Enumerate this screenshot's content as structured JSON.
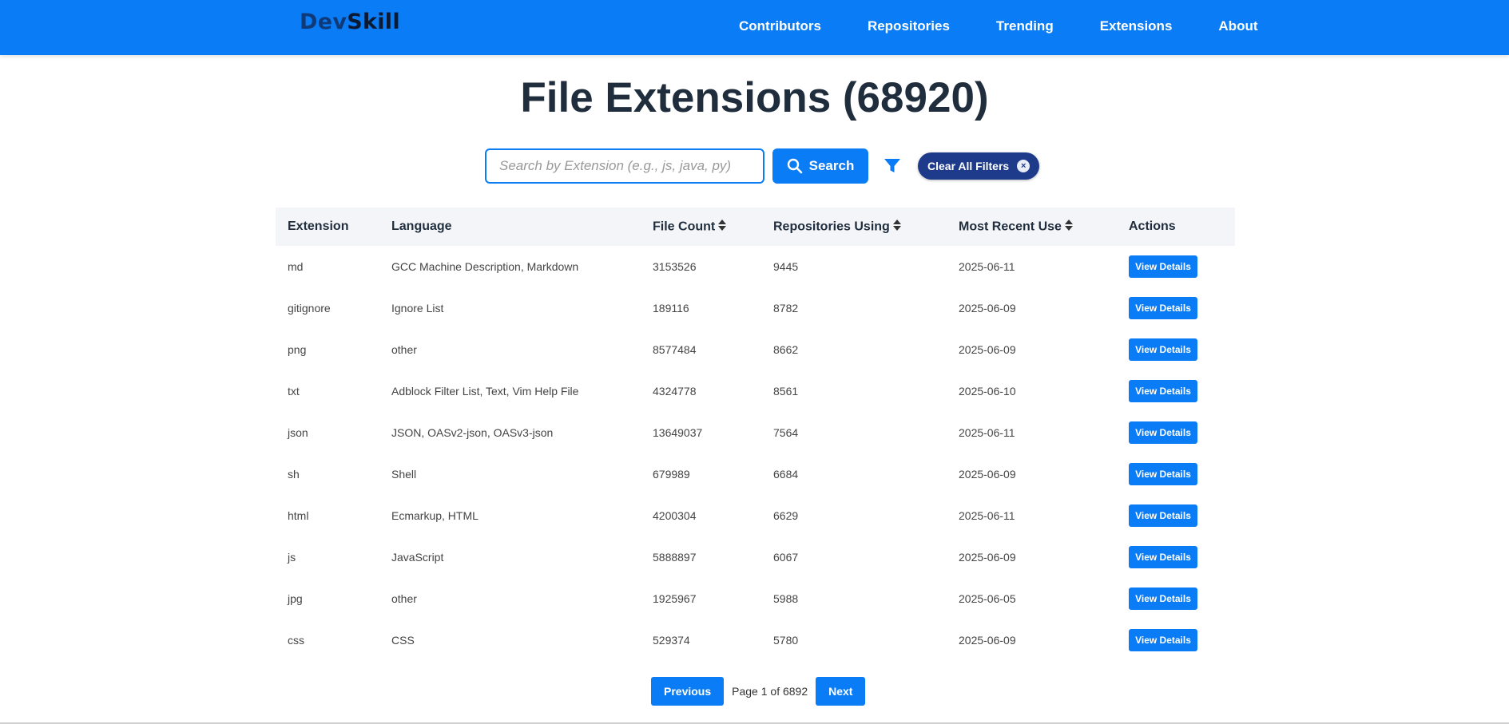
{
  "brand": {
    "part1": "Dev",
    "part2": "Skill"
  },
  "nav": {
    "items": [
      {
        "label": "Contributors"
      },
      {
        "label": "Repositories"
      },
      {
        "label": "Trending"
      },
      {
        "label": "Extensions"
      },
      {
        "label": "About"
      }
    ]
  },
  "page_title": "File Extensions (68920)",
  "search": {
    "placeholder": "Search by Extension (e.g., js, java, py)",
    "value": "",
    "button_label": "Search",
    "clear_label": "Clear All Filters",
    "clear_icon": "×"
  },
  "table": {
    "headers": {
      "extension": "Extension",
      "language": "Language",
      "file_count": "File Count",
      "repositories_using": "Repositories Using",
      "most_recent_use": "Most Recent Use",
      "actions": "Actions"
    },
    "action_label": "View Details",
    "rows": [
      {
        "extension": "md",
        "language": "GCC Machine Description, Markdown",
        "file_count": "3153526",
        "repositories_using": "9445",
        "most_recent_use": "2025-06-11"
      },
      {
        "extension": "gitignore",
        "language": "Ignore List",
        "file_count": "189116",
        "repositories_using": "8782",
        "most_recent_use": "2025-06-09"
      },
      {
        "extension": "png",
        "language": "other",
        "file_count": "8577484",
        "repositories_using": "8662",
        "most_recent_use": "2025-06-09"
      },
      {
        "extension": "txt",
        "language": "Adblock Filter List, Text, Vim Help File",
        "file_count": "4324778",
        "repositories_using": "8561",
        "most_recent_use": "2025-06-10"
      },
      {
        "extension": "json",
        "language": "JSON, OASv2-json, OASv3-json",
        "file_count": "13649037",
        "repositories_using": "7564",
        "most_recent_use": "2025-06-11"
      },
      {
        "extension": "sh",
        "language": "Shell",
        "file_count": "679989",
        "repositories_using": "6684",
        "most_recent_use": "2025-06-09"
      },
      {
        "extension": "html",
        "language": "Ecmarkup, HTML",
        "file_count": "4200304",
        "repositories_using": "6629",
        "most_recent_use": "2025-06-11"
      },
      {
        "extension": "js",
        "language": "JavaScript",
        "file_count": "5888897",
        "repositories_using": "6067",
        "most_recent_use": "2025-06-09"
      },
      {
        "extension": "jpg",
        "language": "other",
        "file_count": "1925967",
        "repositories_using": "5988",
        "most_recent_use": "2025-06-05"
      },
      {
        "extension": "css",
        "language": "CSS",
        "file_count": "529374",
        "repositories_using": "5780",
        "most_recent_use": "2025-06-09"
      }
    ]
  },
  "pagination": {
    "previous_label": "Previous",
    "info": "Page 1 of 6892",
    "next_label": "Next"
  },
  "colors": {
    "primary": "#0a7cf6",
    "clear_button": "#1e3a8a",
    "title": "#1f2d3d",
    "header_bg": "#f4f5f8"
  },
  "icons": {
    "search_button": "search-icon",
    "filter": "filter-icon",
    "sort": "sort-icon",
    "clear": "close-icon"
  }
}
